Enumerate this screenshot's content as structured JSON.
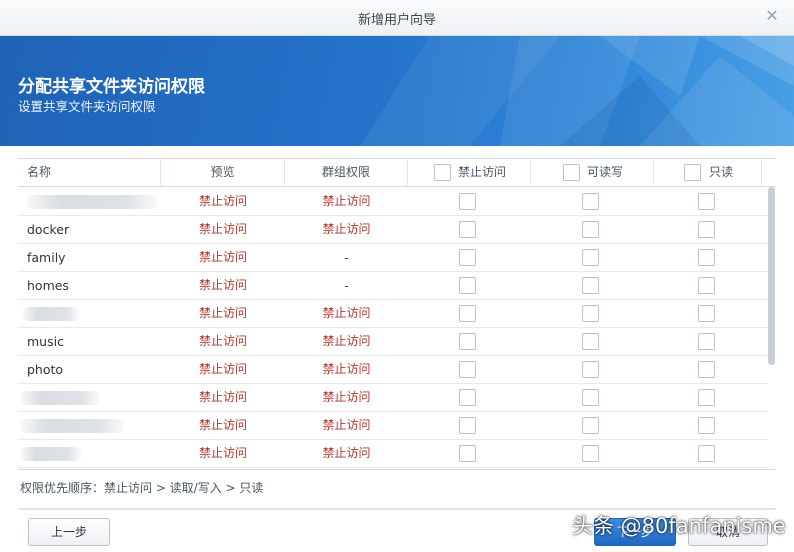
{
  "dialog": {
    "title": "新增用户向导",
    "close_glyph": "✕"
  },
  "banner": {
    "heading": "分配共享文件夹访问权限",
    "subheading": "设置共享文件夹访问权限"
  },
  "table": {
    "columns": {
      "name": "名称",
      "preview": "预览",
      "group_permission": "群组权限",
      "deny": "禁止访问",
      "read_write": "可读写",
      "read_only": "只读"
    },
    "rows": [
      {
        "name": "",
        "name_redacted": true,
        "preview": "禁止访问",
        "group": "禁止访问"
      },
      {
        "name": "docker",
        "name_redacted": false,
        "preview": "禁止访问",
        "group": "禁止访问"
      },
      {
        "name": "family",
        "name_redacted": false,
        "preview": "禁止访问",
        "group": "-"
      },
      {
        "name": "homes",
        "name_redacted": false,
        "preview": "禁止访问",
        "group": "-"
      },
      {
        "name": "",
        "name_redacted": true,
        "preview": "禁止访问",
        "group": "禁止访问"
      },
      {
        "name": "music",
        "name_redacted": false,
        "preview": "禁止访问",
        "group": "禁止访问"
      },
      {
        "name": "photo",
        "name_redacted": false,
        "preview": "禁止访问",
        "group": "禁止访问"
      },
      {
        "name": "",
        "name_redacted": true,
        "preview": "禁止访问",
        "group": "禁止访问"
      },
      {
        "name": "",
        "name_redacted": true,
        "preview": "禁止访问",
        "group": "禁止访问"
      },
      {
        "name": "",
        "name_redacted": true,
        "preview": "禁止访问",
        "group": "禁止访问"
      }
    ]
  },
  "footnote": "权限优先顺序：禁止访问 > 读取/写入 > 只读",
  "buttons": {
    "prev": "上一步",
    "next": "下一步",
    "cancel": "取消"
  },
  "watermark": "头条 @80fanfanisme",
  "colors": {
    "banner_blue": "#2472c8",
    "deny_red": "#b5342a",
    "primary_button": "#1f68c0"
  }
}
